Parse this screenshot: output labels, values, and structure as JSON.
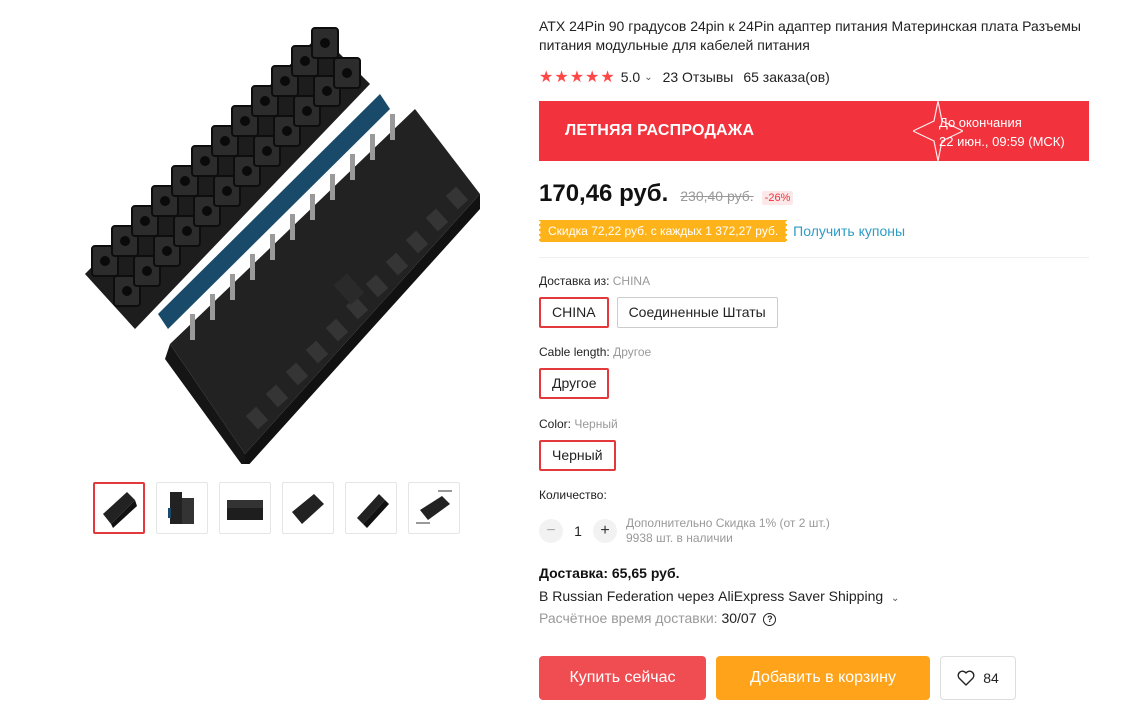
{
  "product": {
    "title": "ATX 24Pin 90 градусов 24pin к 24Pin адаптер питания Материнская плата Разъемы питания модульные для кабелей питания",
    "rating": "5.0",
    "stars": [
      "★",
      "★",
      "★",
      "★",
      "★"
    ],
    "reviews": "23 Отзывы",
    "orders": "65 заказа(ов)"
  },
  "sale": {
    "title": "ЛЕТНЯЯ РАСПРОДАЖА",
    "ends_label": "До окончания",
    "ends_time": "22 июн., 09:59 (МСК)"
  },
  "price": {
    "current": "170,46 руб.",
    "original": "230,40 руб.",
    "discount": "-26%"
  },
  "coupon": {
    "text": "Скидка 72,22 руб. с каждых 1 372,27 руб.",
    "link": "Получить купоны"
  },
  "properties": {
    "ship_from": {
      "label": "Доставка из:",
      "value": "CHINA",
      "options": [
        "CHINA",
        "Соединенные Штаты"
      ]
    },
    "cable_length": {
      "label": "Cable length:",
      "value": "Другое",
      "options": [
        "Другое"
      ]
    },
    "color": {
      "label": "Color:",
      "value": "Черный",
      "options": [
        "Черный"
      ]
    }
  },
  "quantity": {
    "label": "Количество:",
    "minus": "−",
    "plus": "+",
    "value": "1",
    "extra_discount": "Дополнительно Скидка 1% (от 2 шт.)",
    "stock": "9938 шт. в наличии"
  },
  "shipping": {
    "cost": "Доставка: 65,65 руб.",
    "route": "В Russian Federation через AliExpress Saver Shipping",
    "time_label": "Расчётное время доставки:",
    "time_value": "30/07"
  },
  "actions": {
    "buy_now": "Купить сейчас",
    "add_to_cart": "Добавить в корзину",
    "wishlist_count": "84"
  },
  "gallery": {
    "thumbnail_count": 6,
    "active_index": 0
  },
  "colors": {
    "accent_red": "#f2323c",
    "buy_button": "#f04d52",
    "cart_button": "#ffa31a",
    "coupon_bg": "#ffb31a",
    "link_blue": "#2e9cc3"
  }
}
